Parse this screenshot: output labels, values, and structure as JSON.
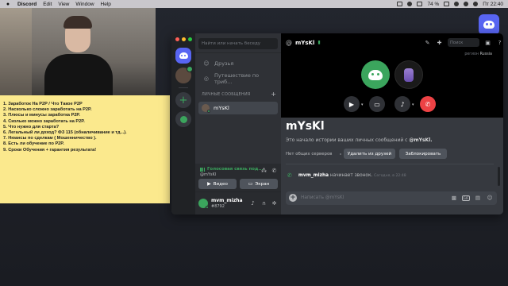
{
  "menubar": {
    "app": "Discord",
    "items": [
      "Edit",
      "View",
      "Window",
      "Help"
    ],
    "battery": "74 %",
    "clock": "Пт 22:40"
  },
  "note": {
    "lines": [
      "1. Заработок На P2P / Что Такое P2P",
      "2. Насколько сложно заработать на P2P.",
      "3. Плюсы и минусы заработка P2P.",
      "4. Сколько можно заработать на P2P.",
      "5. Что нужно для старта?",
      "6. Легальный ли доход? ФЗ 115 (обналичивание и тд...).",
      "7. Нюансы по сделкам ( Мошенничество ).",
      "8. Есть ли обучение по P2P.",
      "9. Сроки Обучения + гарантия результата!"
    ]
  },
  "sidebar": {
    "search_placeholder": "Найти или начать беседу",
    "friends": "Друзья",
    "journey": "Путешествие по триб...",
    "dm_header": "ЛИЧНЫЕ СООБЩЕНИЯ",
    "dm_user": "mYsKl"
  },
  "voice": {
    "status": "Голосовая связь под...",
    "channel": "@mYsKl",
    "video": "Видео",
    "screen": "Экран"
  },
  "user": {
    "name": "mvm_mizha",
    "tag": "#8792"
  },
  "call": {
    "header_name": "mYsKl",
    "search": "Поиск",
    "region_label": "регион",
    "region_value": "Russia"
  },
  "profile": {
    "title": "mYsKl",
    "intro_prefix": "Это начало истории ваших личных сообщений с",
    "intro_user": "@mYsKl.",
    "mutual": "Нет общих серверов",
    "remove_friend": "Удалить из друзей",
    "block": "Заблокировать"
  },
  "message": {
    "author": "mvm_mizha",
    "text": "начинает звонок.",
    "time": "Сегодня, в 22:48"
  },
  "composer": {
    "placeholder": "Написать @mYsKl",
    "gif": "GIF"
  },
  "colors": {
    "accent": "#5865f2",
    "online": "#3ba55d",
    "danger": "#ed4245",
    "note_bg": "#fbe98d"
  }
}
